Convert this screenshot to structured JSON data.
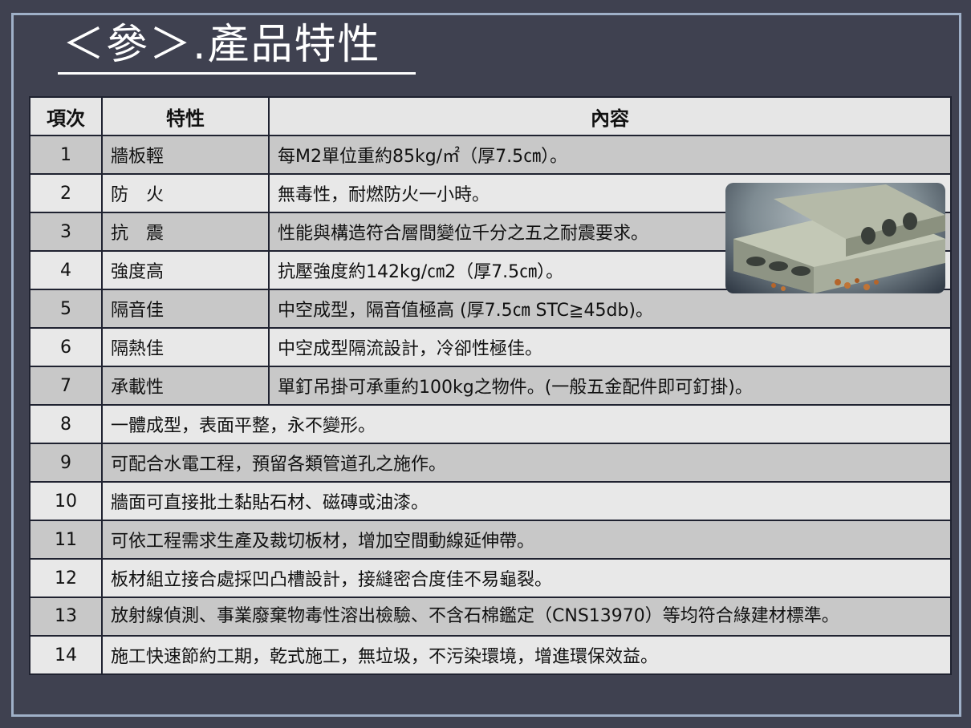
{
  "title": "＜參＞.產品特性",
  "table": {
    "headers": [
      "項次",
      "特性",
      "內容"
    ],
    "rows": [
      {
        "num": "1",
        "feature": "牆板輕",
        "content": "每M2單位重約85kg/㎡（厚7.5㎝）。"
      },
      {
        "num": "2",
        "feature": "防　火",
        "content": "無毒性，耐燃防火一小時。"
      },
      {
        "num": "3",
        "feature": "抗　震",
        "content": "性能與構造符合層間變位千分之五之耐震要求。"
      },
      {
        "num": "4",
        "feature": "強度高",
        "content": "抗壓強度約142kg/㎝2（厚7.5㎝）。"
      },
      {
        "num": "5",
        "feature": "隔音佳",
        "content": "中空成型，隔音值極高 (厚7.5㎝ STC≧45db)。"
      },
      {
        "num": "6",
        "feature": "隔熱佳",
        "content": "中空成型隔流設計，冷卻性極佳。"
      },
      {
        "num": "7",
        "feature": "承載性",
        "content": "單釘吊掛可承重約100kg之物件。(一般五金配件即可釘掛)。"
      }
    ],
    "wide_rows": [
      {
        "num": "8",
        "content": "一體成型，表面平整，永不變形。"
      },
      {
        "num": "9",
        "content": "可配合水電工程，預留各類管道孔之施作。"
      },
      {
        "num": "10",
        "content": "牆面可直接批土黏貼石材、磁磚或油漆。"
      },
      {
        "num": "11",
        "content": "可依工程需求生產及裁切板材，增加空間動線延伸帶。"
      },
      {
        "num": "12",
        "content": "板材組立接合處採凹凸槽設計，接縫密合度佳不易龜裂。"
      },
      {
        "num": "13",
        "content": "放射線偵測、事業廢棄物毒性溶出檢驗、不含石棉鑑定（CNS13970）等均符合綠建材標準。"
      },
      {
        "num": "14",
        "content": "施工快速節約工期，乾式施工，無垃圾，不污染環境，增進環保效益。"
      }
    ]
  },
  "photo": {
    "icon": "hollow-core-panel-image"
  }
}
